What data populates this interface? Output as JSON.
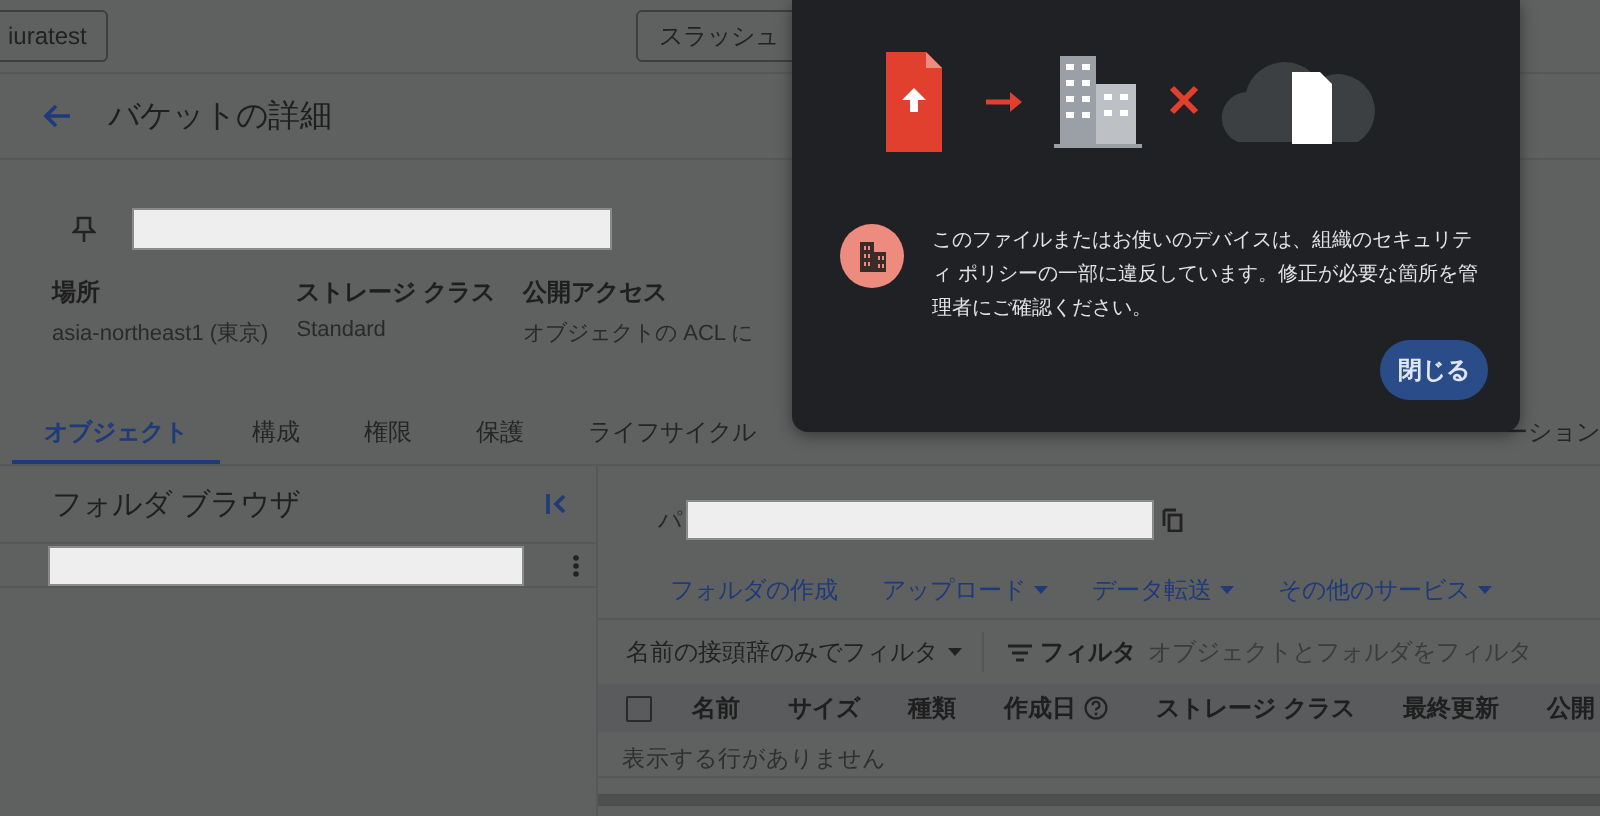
{
  "top_bar": {
    "buttons": [
      "iuratest",
      "スラッシュ"
    ]
  },
  "header": {
    "title": "バケットの詳細"
  },
  "bucket": {
    "properties": [
      {
        "label": "場所",
        "value": "asia-northeast1 (東京)"
      },
      {
        "label": "ストレージ クラス",
        "value": "Standard"
      },
      {
        "label": "公開アクセス",
        "value": "オブジェクトの ACL に"
      }
    ]
  },
  "tabs": [
    {
      "label": "オブジェクト",
      "selected": true
    },
    {
      "label": "構成",
      "selected": false
    },
    {
      "label": "権限",
      "selected": false
    },
    {
      "label": "保護",
      "selected": false
    },
    {
      "label": "ライフサイクル",
      "selected": false
    },
    {
      "label": "ーション",
      "selected": false
    }
  ],
  "folder_browser": {
    "title": "フォルダ ブラウザ"
  },
  "objects": {
    "path_prefix": "パ",
    "actions": [
      {
        "label": "フォルダの作成",
        "dropdown": false
      },
      {
        "label": "アップロード",
        "dropdown": true
      },
      {
        "label": "データ転送",
        "dropdown": true
      },
      {
        "label": "その他のサービス",
        "dropdown": true
      }
    ],
    "filter": {
      "prefix_filter": "名前の接頭辞のみでフィルタ",
      "label": "フィルタ",
      "placeholder": "オブジェクトとフォルダをフィルタ"
    },
    "table": {
      "select_all": {
        "checked": false
      },
      "columns": [
        {
          "label": "名前",
          "help": false
        },
        {
          "label": "サイズ",
          "help": false
        },
        {
          "label": "種類",
          "help": false
        },
        {
          "label": "作成日",
          "help": true
        },
        {
          "label": "ストレージ クラス",
          "help": false
        },
        {
          "label": "最終更新",
          "help": false
        },
        {
          "label": "公開",
          "help": false
        }
      ],
      "empty_message": "表示する行がありません"
    }
  },
  "dialog": {
    "message": "このファイルまたはお使いのデバイスは、組織のセキュリティ ポリシーの一部に違反しています。修正が必要な箇所を管理者にご確認ください。",
    "button": "閉じる"
  }
}
